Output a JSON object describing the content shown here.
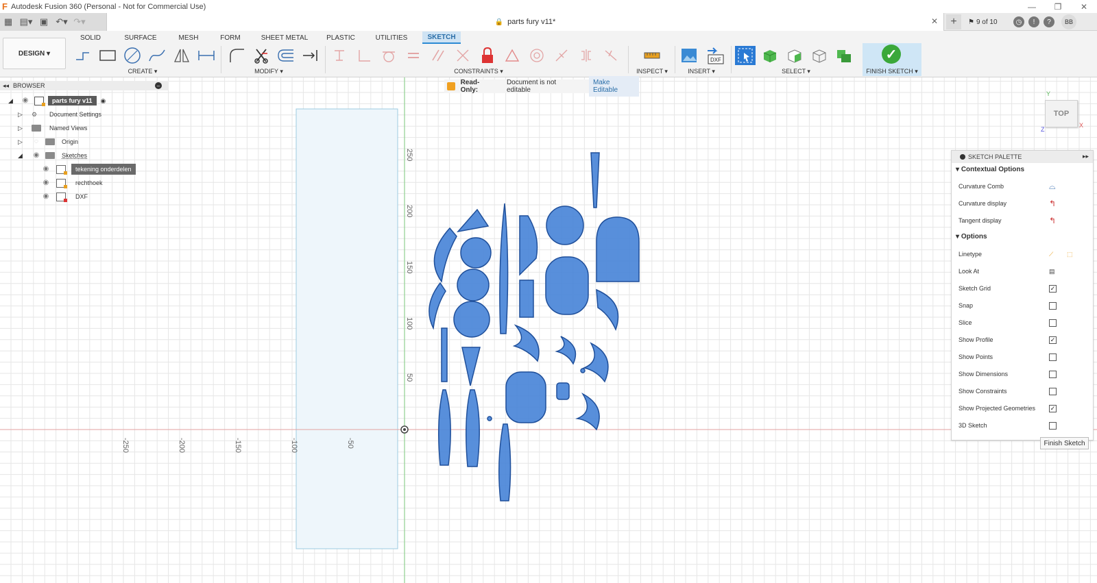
{
  "titlebar": {
    "title": "Autodesk Fusion 360 (Personal - Not for Commercial Use)",
    "minimize": "—",
    "restore": "❐",
    "close": "✕"
  },
  "quickbar": {
    "doc_title": "parts fury v11*",
    "jobs": "9 of 10",
    "user_initials": "BB"
  },
  "ribbon": {
    "workspace": "DESIGN ▾",
    "tabs": [
      "SOLID",
      "SURFACE",
      "MESH",
      "FORM",
      "SHEET METAL",
      "PLASTIC",
      "UTILITIES",
      "SKETCH"
    ],
    "active_tab": "SKETCH",
    "groups": {
      "create": "CREATE ▾",
      "modify": "MODIFY ▾",
      "constraints": "CONSTRAINTS ▾",
      "inspect": "INSPECT ▾",
      "insert": "INSERT ▾",
      "select": "SELECT ▾",
      "finish": "FINISH SKETCH ▾"
    },
    "dxf_label": "DXF"
  },
  "browser": {
    "title": "BROWSER",
    "root": "parts fury v11",
    "items": [
      {
        "label": "Document Settings"
      },
      {
        "label": "Named Views"
      },
      {
        "label": "Origin"
      },
      {
        "label": "Sketches"
      }
    ],
    "sketches": [
      {
        "label": "tekening onderdelen"
      },
      {
        "label": "rechthoek"
      },
      {
        "label": "DXF"
      }
    ]
  },
  "readonly_banner": {
    "label": "Read-Only:",
    "message": "Document is not editable",
    "action": "Make Editable"
  },
  "canvas": {
    "x_ticks": [
      "-250",
      "-200",
      "-150",
      "-100",
      "-50"
    ],
    "y_ticks": [
      "250",
      "200",
      "150",
      "100",
      "50"
    ],
    "colors": {
      "grid": "#e6e6e6",
      "x_axis": "#e3a1a1",
      "y_axis": "#8fd08f",
      "shape_fill": "#4a86d8",
      "shape_stroke": "#1f4f9a",
      "rect_fill": "#eef6fb",
      "rect_stroke": "#9ccbe0"
    }
  },
  "viewcube": {
    "face": "TOP",
    "x": "X",
    "y": "Y",
    "z": "Z"
  },
  "palette": {
    "title": "SKETCH PALETTE",
    "contextual_title": "Contextual Options",
    "contextual": [
      {
        "label": "Curvature Comb"
      },
      {
        "label": "Curvature display"
      },
      {
        "label": "Tangent display"
      }
    ],
    "options_title": "Options",
    "options": [
      {
        "label": "Linetype",
        "kind": "icons"
      },
      {
        "label": "Look At",
        "kind": "icon"
      },
      {
        "label": "Sketch Grid",
        "checked": true
      },
      {
        "label": "Snap",
        "checked": false
      },
      {
        "label": "Slice",
        "checked": false
      },
      {
        "label": "Show Profile",
        "checked": true
      },
      {
        "label": "Show Points",
        "checked": false
      },
      {
        "label": "Show Dimensions",
        "checked": false
      },
      {
        "label": "Show Constraints",
        "checked": false
      },
      {
        "label": "Show Projected Geometries",
        "checked": true
      },
      {
        "label": "3D Sketch",
        "checked": false
      }
    ],
    "finish_button": "Finish Sketch"
  }
}
